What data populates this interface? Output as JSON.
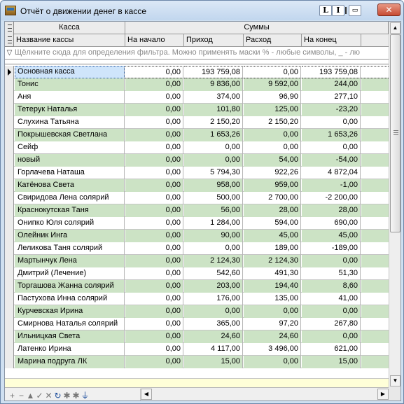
{
  "window": {
    "title": "Отчёт о движении денег в кассе",
    "buttons": {
      "l": "L",
      "i": "I",
      "restore": "▭",
      "close": "✕"
    }
  },
  "header": {
    "group_kassa": "Касса",
    "group_sums": "Суммы",
    "columns": [
      "Название кассы",
      "На начало",
      "Приход",
      "Расход",
      "На конец"
    ]
  },
  "filter": {
    "placeholder": "Щёлкните сюда для определения фильтра. Можно применять маски % - любые символы, _ - лю"
  },
  "rows": [
    {
      "name": "Основная касса",
      "start": "0,00",
      "income": "193 759,08",
      "expense": "0,00",
      "end": "193 759,08"
    },
    {
      "name": "Тонис",
      "start": "0,00",
      "income": "9 836,00",
      "expense": "9 592,00",
      "end": "244,00"
    },
    {
      "name": "Аня",
      "start": "0,00",
      "income": "374,00",
      "expense": "96,90",
      "end": "277,10"
    },
    {
      "name": "Тетерук Наталья",
      "start": "0,00",
      "income": "101,80",
      "expense": "125,00",
      "end": "-23,20"
    },
    {
      "name": "Слухина Татьяна",
      "start": "0,00",
      "income": "2 150,20",
      "expense": "2 150,20",
      "end": "0,00"
    },
    {
      "name": "Покрышевская Светлана",
      "start": "0,00",
      "income": "1 653,26",
      "expense": "0,00",
      "end": "1 653,26"
    },
    {
      "name": "Сейф",
      "start": "0,00",
      "income": "0,00",
      "expense": "0,00",
      "end": "0,00"
    },
    {
      "name": "новый",
      "start": "0,00",
      "income": "0,00",
      "expense": "54,00",
      "end": "-54,00"
    },
    {
      "name": "Горлачева Наташа",
      "start": "0,00",
      "income": "5 794,30",
      "expense": "922,26",
      "end": "4 872,04"
    },
    {
      "name": "Катёнова Света",
      "start": "0,00",
      "income": "958,00",
      "expense": "959,00",
      "end": "-1,00"
    },
    {
      "name": "Свиридова Лена солярий",
      "start": "0,00",
      "income": "500,00",
      "expense": "2 700,00",
      "end": "-2 200,00"
    },
    {
      "name": "Краснокутская Таня",
      "start": "0,00",
      "income": "56,00",
      "expense": "28,00",
      "end": "28,00"
    },
    {
      "name": "Онипко Юля солярий",
      "start": "0,00",
      "income": "1 284,00",
      "expense": "594,00",
      "end": "690,00"
    },
    {
      "name": "Олейник Инга",
      "start": "0,00",
      "income": "90,00",
      "expense": "45,00",
      "end": "45,00"
    },
    {
      "name": "Леликова Таня солярий",
      "start": "0,00",
      "income": "0,00",
      "expense": "189,00",
      "end": "-189,00"
    },
    {
      "name": "Мартынчук Лена",
      "start": "0,00",
      "income": "2 124,30",
      "expense": "2 124,30",
      "end": "0,00"
    },
    {
      "name": "Дмитрий (Лечение)",
      "start": "0,00",
      "income": "542,60",
      "expense": "491,30",
      "end": "51,30"
    },
    {
      "name": "Торгашова Жанна солярий",
      "start": "0,00",
      "income": "203,00",
      "expense": "194,40",
      "end": "8,60"
    },
    {
      "name": "Пастухова Инна солярий",
      "start": "0,00",
      "income": "176,00",
      "expense": "135,00",
      "end": "41,00"
    },
    {
      "name": "Курчевская Ирина",
      "start": "0,00",
      "income": "0,00",
      "expense": "0,00",
      "end": "0,00"
    },
    {
      "name": "Смирнова Наталья солярий",
      "start": "0,00",
      "income": "365,00",
      "expense": "97,20",
      "end": "267,80"
    },
    {
      "name": "Ильницкая Света",
      "start": "0,00",
      "income": "24,60",
      "expense": "24,60",
      "end": "0,00"
    },
    {
      "name": "Латенко Ирина",
      "start": "0,00",
      "income": "4 117,00",
      "expense": "3 496,00",
      "end": "621,00"
    },
    {
      "name": "Марина подруга ЛК",
      "start": "0,00",
      "income": "15,00",
      "expense": "0,00",
      "end": "15,00"
    }
  ],
  "navigator": [
    "+",
    "−",
    "▲",
    "✓",
    "✕",
    "↻",
    "✱",
    "✱",
    "⏚"
  ],
  "colors": {
    "band_green": "#cce3c5",
    "selected": "#cfe5fb",
    "empty_area": "#ffffd8"
  }
}
